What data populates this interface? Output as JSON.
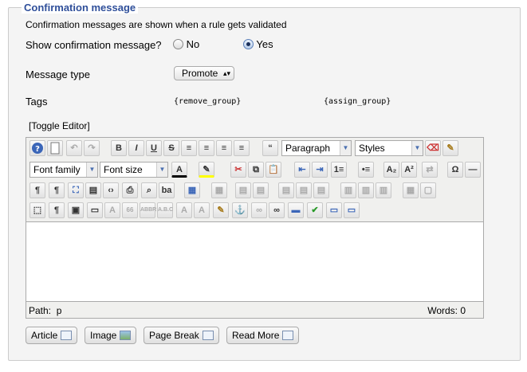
{
  "legend": "Confirmation message",
  "description": "Confirmation messages are shown when a rule gets validated",
  "show_confirmation": {
    "label": "Show confirmation message?",
    "no": "No",
    "yes": "Yes",
    "selected": "Yes"
  },
  "message_type": {
    "label": "Message type",
    "value": "Promote"
  },
  "tags": {
    "label": "Tags",
    "items": [
      "{remove_group}",
      "{assign_group}"
    ]
  },
  "toggle_editor": "[Toggle Editor]",
  "editor": {
    "format_select": "Paragraph",
    "styles_select": "Styles",
    "font_family": "Font family",
    "font_size": "Font size",
    "path_label": "Path:",
    "path_value": "p",
    "words_label": "Words: 0"
  },
  "buttons": {
    "article": "Article",
    "image": "Image",
    "page_break": "Page Break",
    "read_more": "Read More"
  }
}
